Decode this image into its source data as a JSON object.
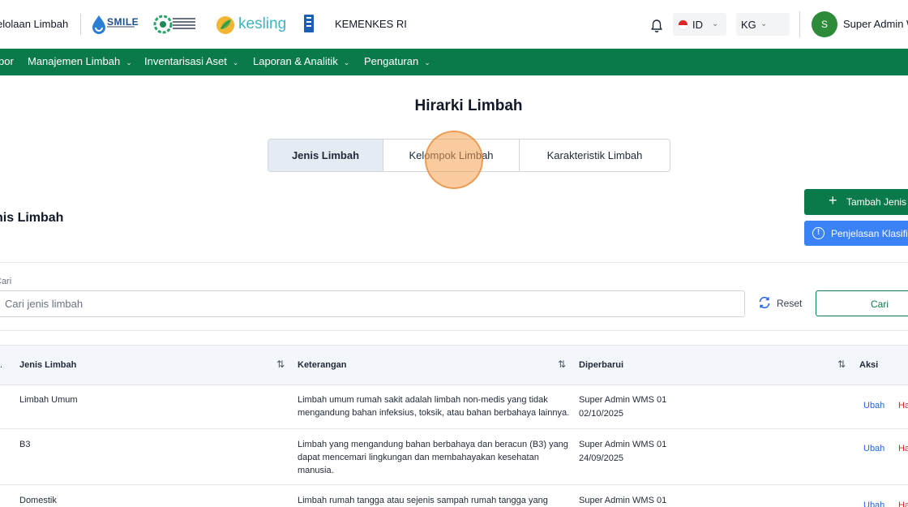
{
  "header": {
    "brand_partial": "elolaan Limbah",
    "smile_logo_text": "SMILE",
    "kesling_logo_text": "kesling",
    "ministry": "KEMENKES RI",
    "language": "ID",
    "unit": "KG",
    "avatar_initial": "S",
    "user_name": "Super Admin W"
  },
  "nav": {
    "items": [
      {
        "label": "bor"
      },
      {
        "label": "Manajemen Limbah"
      },
      {
        "label": "Inventarisasi Aset"
      },
      {
        "label": "Laporan & Analitik"
      },
      {
        "label": "Pengaturan"
      }
    ]
  },
  "page": {
    "title": "Hirarki Limbah",
    "tabs": [
      {
        "label": "Jenis Limbah",
        "active": true
      },
      {
        "label": "Kelompok Limbah",
        "active": false
      },
      {
        "label": "Karakteristik Limbah",
        "active": false
      }
    ]
  },
  "section": {
    "title": "nis Limbah",
    "add_button": "Tambah Jenis Li",
    "info_button": "Penjelasan Klasifika"
  },
  "search": {
    "label": "Cari",
    "placeholder": "Cari jenis limbah",
    "value": "",
    "reset_label": "Reset",
    "submit_label": "Cari"
  },
  "table": {
    "headers": {
      "name": "Jenis Limbah",
      "description": "Keterangan",
      "updated": "Diperbarui",
      "actions": "Aksi"
    },
    "rows": [
      {
        "name": "Limbah Umum",
        "description": "Limbah umum rumah sakit adalah limbah non-medis yang tidak mengandung bahan infeksius, toksik, atau bahan berbahaya lainnya.",
        "updated_by": "Super Admin WMS 01",
        "updated_at": "02/10/2025",
        "edit": "Ubah",
        "delete": "Ha"
      },
      {
        "name": "B3",
        "description": "Limbah yang mengandung bahan berbahaya dan beracun (B3) yang dapat mencemari lingkungan dan membahayakan kesehatan manusia.",
        "updated_by": "Super Admin WMS 01",
        "updated_at": "24/09/2025",
        "edit": "Ubah",
        "delete": "Ha"
      },
      {
        "name": "Domestik",
        "description": "Limbah rumah tangga atau sejenis sampah rumah tangga yang",
        "updated_by": "Super Admin WMS 01",
        "updated_at": "",
        "edit": "Ubah",
        "delete": "Ha"
      }
    ]
  },
  "colors": {
    "primary_green": "#0b7a4b",
    "info_blue": "#3b82f6",
    "link_blue": "#2563eb",
    "danger_red": "#dc2626",
    "active_tab_bg": "#e5ebf2"
  },
  "icons": [
    "bell-icon",
    "flag-id-icon",
    "chevron-down-icon",
    "plus-icon",
    "info-icon",
    "refresh-icon",
    "sort-icon"
  ]
}
